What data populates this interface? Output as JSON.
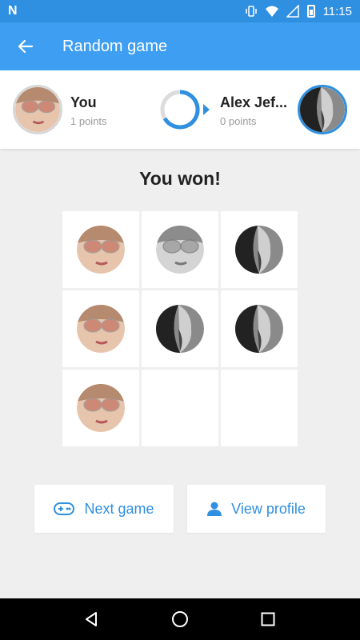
{
  "status_bar": {
    "time": "11:15",
    "notification_icon": "N"
  },
  "app_bar": {
    "title": "Random game",
    "back_icon": "arrow-back-icon"
  },
  "players": {
    "you": {
      "name": "You",
      "points": "1 points"
    },
    "opponent": {
      "name": "Alex Jef...",
      "points": "0 points"
    },
    "turn_icon": "turn-progress-arrow-icon"
  },
  "result": {
    "text": "You won!"
  },
  "board": {
    "cells": [
      "you",
      "you-grey",
      "alex",
      "you",
      "alex",
      "alex",
      "you",
      "empty",
      "empty"
    ]
  },
  "actions": {
    "next_game": {
      "label": "Next game",
      "icon": "gamepad-icon"
    },
    "view_profile": {
      "label": "View profile",
      "icon": "person-icon"
    }
  },
  "nav_bar": {
    "items": [
      "back-triangle-icon",
      "home-circle-icon",
      "recents-square-icon"
    ]
  },
  "colors": {
    "primary": "#3d9ef2",
    "status_bar": "#2f8fe0",
    "accent": "#2f8fe0"
  }
}
